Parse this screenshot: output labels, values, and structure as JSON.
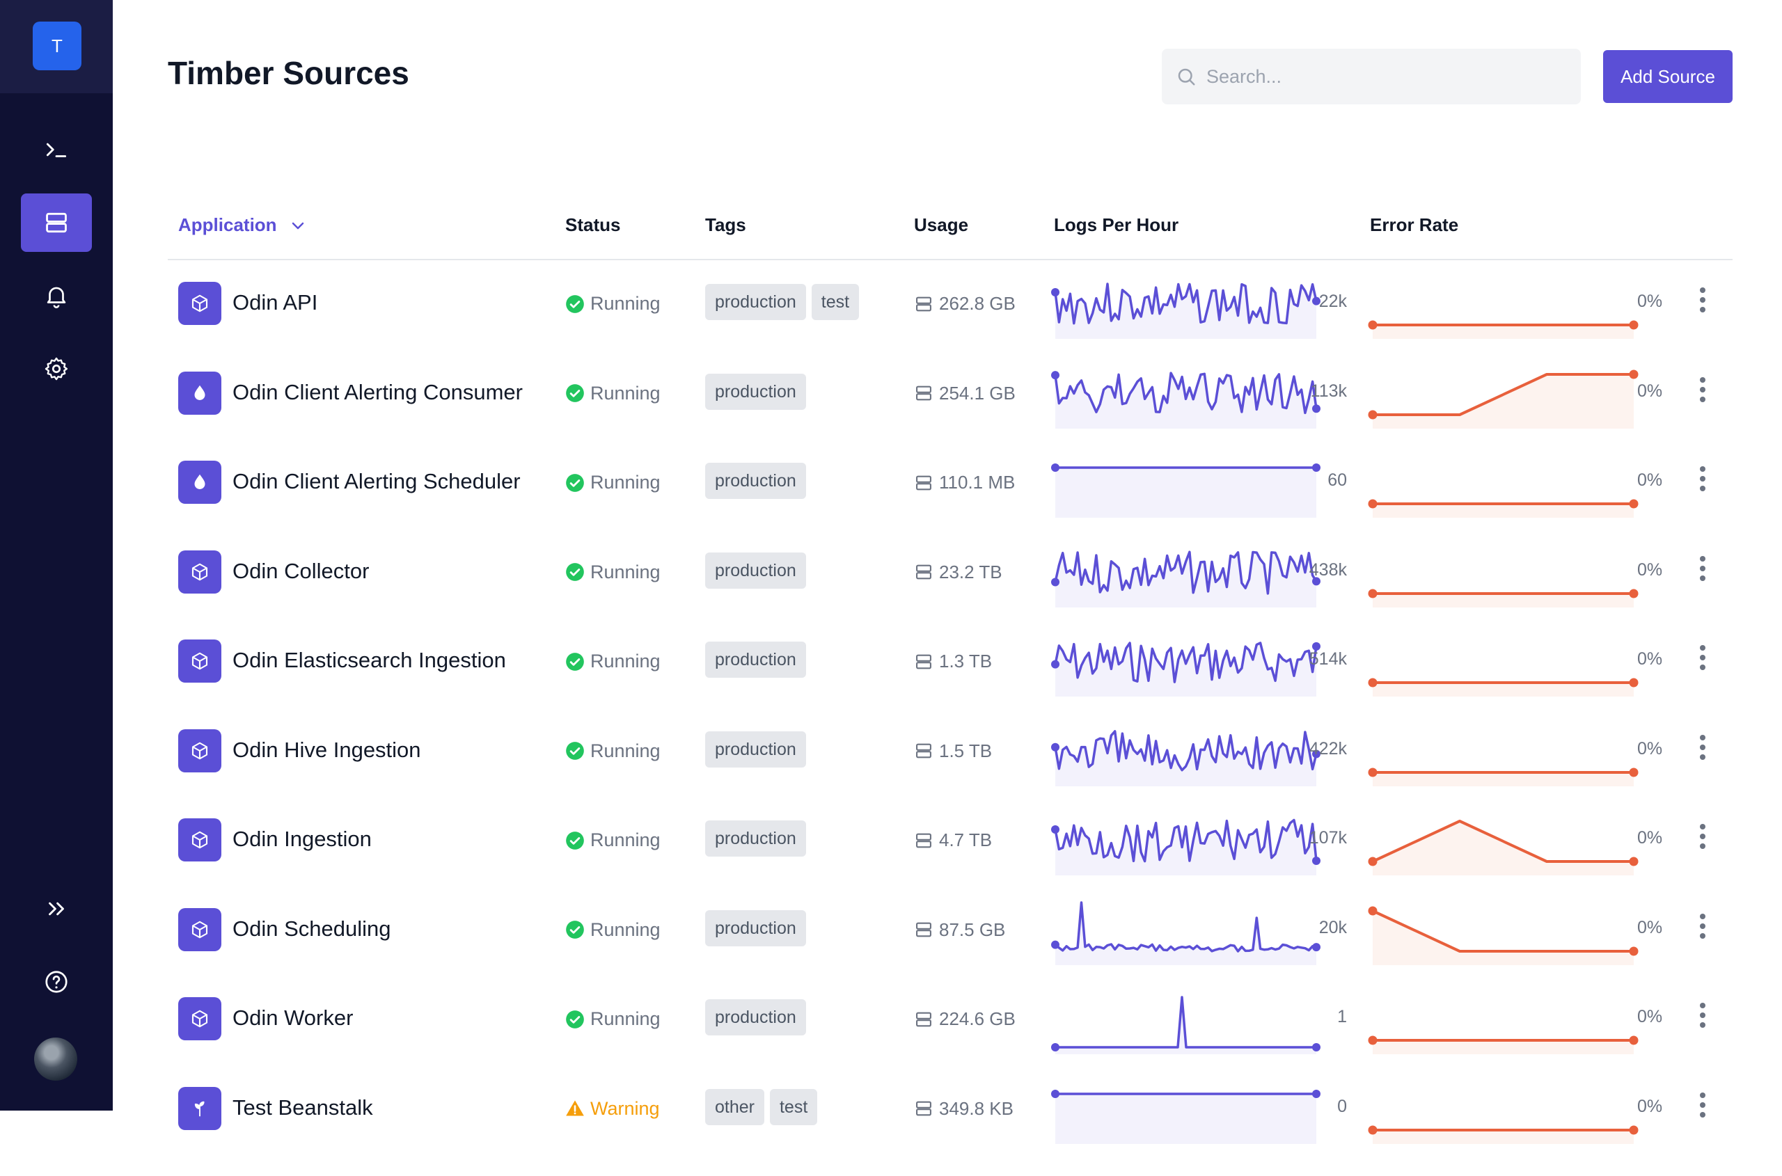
{
  "sidebar": {
    "brand_letter": "T",
    "items": [
      {
        "name": "terminal-icon",
        "active": false
      },
      {
        "name": "server-icon",
        "active": true
      },
      {
        "name": "bell-icon",
        "active": false
      },
      {
        "name": "gear-icon",
        "active": false
      }
    ],
    "bottom": [
      "expand-icon",
      "help-icon",
      "avatar"
    ]
  },
  "header": {
    "title": "Timber Sources",
    "search_placeholder": "Search...",
    "add_button": "Add Source"
  },
  "table": {
    "columns": {
      "application": "Application",
      "status": "Status",
      "tags": "Tags",
      "usage": "Usage",
      "logs_per_hour": "Logs Per Hour",
      "error_rate": "Error Rate"
    },
    "rows": [
      {
        "name": "Odin API",
        "icon": "box-icon",
        "status": "Running",
        "status_type": "running",
        "tags": [
          "production",
          "test"
        ],
        "usage": "262.8 GB",
        "logs_label": "22k",
        "logs_pattern": "noisy",
        "error_label": "0%",
        "error_values": [
          0,
          0,
          0,
          0
        ]
      },
      {
        "name": "Odin Client Alerting Consumer",
        "icon": "drop-icon",
        "status": "Running",
        "status_type": "running",
        "tags": [
          "production"
        ],
        "usage": "254.1 GB",
        "logs_label": "113k",
        "logs_pattern": "noisy",
        "error_label": "0%",
        "error_values": [
          0,
          0,
          1,
          1
        ]
      },
      {
        "name": "Odin Client Alerting Scheduler",
        "icon": "drop-icon",
        "status": "Running",
        "status_type": "running",
        "tags": [
          "production"
        ],
        "usage": "110.1 MB",
        "logs_label": "60",
        "logs_pattern": "flat",
        "error_label": "0%",
        "error_values": [
          0,
          0,
          0,
          0
        ]
      },
      {
        "name": "Odin Collector",
        "icon": "box-icon",
        "status": "Running",
        "status_type": "running",
        "tags": [
          "production"
        ],
        "usage": "23.2 TB",
        "logs_label": "438k",
        "logs_pattern": "noisy",
        "error_label": "0%",
        "error_values": [
          0,
          0,
          0,
          0
        ]
      },
      {
        "name": "Odin Elasticsearch Ingestion",
        "icon": "box-icon",
        "status": "Running",
        "status_type": "running",
        "tags": [
          "production"
        ],
        "usage": "1.3 TB",
        "logs_label": "514k",
        "logs_pattern": "noisy",
        "error_label": "0%",
        "error_values": [
          0,
          0,
          0,
          0
        ]
      },
      {
        "name": "Odin Hive Ingestion",
        "icon": "box-icon",
        "status": "Running",
        "status_type": "running",
        "tags": [
          "production"
        ],
        "usage": "1.5 TB",
        "logs_label": "422k",
        "logs_pattern": "noisy",
        "error_label": "0%",
        "error_values": [
          0,
          0,
          0,
          0
        ]
      },
      {
        "name": "Odin Ingestion",
        "icon": "box-icon",
        "status": "Running",
        "status_type": "running",
        "tags": [
          "production"
        ],
        "usage": "4.7 TB",
        "logs_label": "107k",
        "logs_pattern": "noisy",
        "error_label": "0%",
        "error_values": [
          0,
          1,
          0,
          0
        ]
      },
      {
        "name": "Odin Scheduling",
        "icon": "box-icon",
        "status": "Running",
        "status_type": "running",
        "tags": [
          "production"
        ],
        "usage": "87.5 GB",
        "logs_label": "20k",
        "logs_pattern": "spiky",
        "error_label": "0%",
        "error_values": [
          1,
          0,
          0,
          0
        ]
      },
      {
        "name": "Odin Worker",
        "icon": "box-icon",
        "status": "Running",
        "status_type": "running",
        "tags": [
          "production"
        ],
        "usage": "224.6 GB",
        "logs_label": "1",
        "logs_pattern": "single-spike",
        "error_label": "0%",
        "error_values": [
          0,
          0,
          0,
          0
        ]
      },
      {
        "name": "Test Beanstalk",
        "icon": "beanstalk-icon",
        "status": "Warning",
        "status_type": "warning",
        "tags": [
          "other",
          "test"
        ],
        "usage": "349.8 KB",
        "logs_label": "0",
        "logs_pattern": "flat",
        "error_label": "0%",
        "error_values": [
          0,
          0,
          0,
          0
        ]
      }
    ]
  },
  "colors": {
    "sidebar_bg": "#0f1133",
    "accent": "#5b4fd6",
    "running": "#22c55e",
    "warning": "#f59e0b",
    "error_line": "#e8603c"
  }
}
